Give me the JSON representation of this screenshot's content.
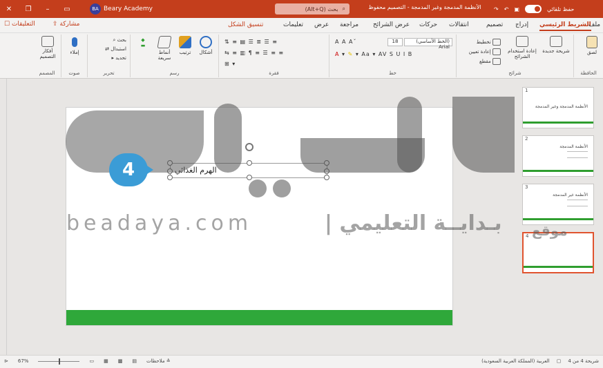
{
  "titlebar": {
    "account": "Beary Academy",
    "account_initials": "BA",
    "search_hint": "(Alt+Q) بحث",
    "doc_title": "الأنظمة المدمجة وغير المدمجة - التصميم محفوظ",
    "autosave": "حفظ تلقائي",
    "icons": [
      "close-icon",
      "minimize-icon",
      "restore-icon",
      "save-icon",
      "undo-icon",
      "redo-icon"
    ]
  },
  "tabs": {
    "file": "ملف",
    "home": "الشريط الرئيسي",
    "insert": "إدراج",
    "design": "تصميم",
    "transitions": "انتقالات",
    "animations": "حركات",
    "slideshow": "عرض الشرائح",
    "review": "مراجعة",
    "view": "عرض",
    "help": "تعليمات",
    "shape_format": "تنسيق الشكل",
    "share": "مشاركة",
    "comments": "التعليقات"
  },
  "ribbon": {
    "clipboard_label": "الحافظة",
    "paste": "لصق",
    "slides_label": "شرائح",
    "new_slide": "شريحة جديدة",
    "reuse_slides": "إعادة استخدام الشرائح",
    "layout": "تخطيط",
    "reset": "إعادة تعيين",
    "section": "مقطع",
    "font_label": "خط",
    "font_name": "(الخط الأساسي) Arial",
    "font_size": "18",
    "paragraph_label": "فقرة",
    "drawing_label": "رسم",
    "shapes": "أشكال",
    "arrange": "ترتيب",
    "quick_styles": "أنماط سريعة",
    "editing_label": "تحرير",
    "find": "بحث",
    "replace": "استبدال",
    "select": "تحديد",
    "voice_label": "صوت",
    "dictate": "إملاء",
    "designer_label": "المصمم",
    "design_ideas": "أفكار التصميم"
  },
  "slides": [
    {
      "num": "1",
      "title": "الأنظمة المدمجة وغير المدمجة"
    },
    {
      "num": "2",
      "title": "الأنظمة المدمجة"
    },
    {
      "num": "3",
      "title": "الأنظمة غير المدمجة"
    },
    {
      "num": "4",
      "title": ""
    }
  ],
  "canvas": {
    "textbox_text": "الهرم الغذائي",
    "step_number": "4"
  },
  "watermark": {
    "domain": "beadaya.com",
    "separator": "|",
    "arabic": "بـدايــة التعليمي",
    "arabic2": "موقع"
  },
  "status": {
    "slide_info": "شريحة 4 من 4",
    "language": "العربية (المملكة العربية السعودية)",
    "notes": "ملاحظات",
    "zoom": "67%"
  },
  "colors": {
    "accent": "#c43e1c",
    "green_bar": "#2fa83a",
    "badge": "#3b9cd6"
  }
}
